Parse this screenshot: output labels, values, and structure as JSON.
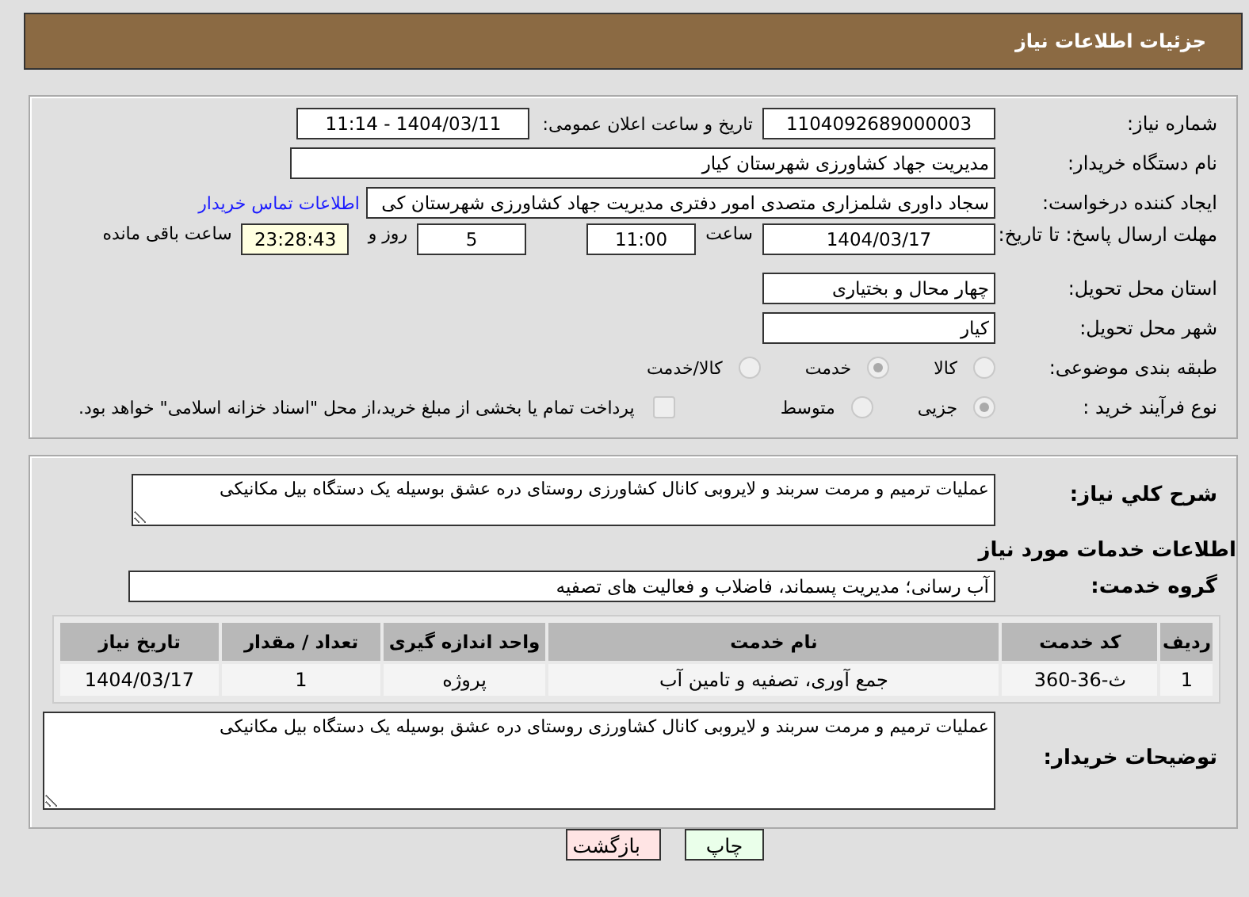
{
  "header": {
    "title": "جزئیات اطلاعات نیاز"
  },
  "need": {
    "number_label": "شماره نیاز:",
    "number": "1104092689000003",
    "announce_label": "تاریخ و ساعت اعلان عمومی:",
    "announce": "1404/03/11 - 11:14",
    "buyer_label": "نام دستگاه خریدار:",
    "buyer": "مدیریت جهاد کشاورزی شهرستان کیار",
    "creator_label": "ایجاد کننده درخواست:",
    "creator": "سجاد داوری شلمزاری متصدی امور دفتری مدیریت جهاد کشاورزی شهرستان کی",
    "contact_link": "اطلاعات تماس خریدار",
    "deadline_label": "مهلت ارسال پاسخ: تا تاریخ:",
    "deadline_date": "1404/03/17",
    "time_label": "ساعت",
    "deadline_time": "11:00",
    "days": "5",
    "days_label": "روز و",
    "remaining": "23:28:43",
    "remaining_label": "ساعت باقی مانده",
    "province_label": "استان محل تحویل:",
    "province": "چهار محال و بختیاری",
    "city_label": "شهر محل تحویل:",
    "city": "کیار",
    "category": {
      "label": "طبقه بندی موضوعی:",
      "options": [
        {
          "label": "کالا",
          "selected": false
        },
        {
          "label": "خدمت",
          "selected": true
        },
        {
          "label": "کالا/خدمت",
          "selected": false
        }
      ]
    },
    "process": {
      "label": "نوع فرآیند خرید :",
      "options": [
        {
          "label": "جزیی",
          "selected": true
        },
        {
          "label": "متوسط",
          "selected": false
        }
      ],
      "checkbox": {
        "label": "پرداخت تمام یا بخشی از مبلغ خرید،از محل \"اسناد خزانه اسلامی\" خواهد بود.",
        "checked": false
      }
    }
  },
  "services": {
    "summary_label": "شرح کلي نياز:",
    "summary": "عملیات ترمیم و مرمت سربند و لایروبی کانال کشاورزی روستای دره عشق بوسیله یک دستگاه بیل مکانیکی",
    "heading": "اطلاعات خدمات مورد نیاز",
    "group_label": "گروه خدمت:",
    "group": "آب رسانی؛ مدیریت پسماند، فاضلاب و فعالیت های تصفیه",
    "table": {
      "columns": [
        "ردیف",
        "کد خدمت",
        "نام خدمت",
        "واحد اندازه گیری",
        "تعداد / مقدار",
        "تاریخ نیاز"
      ],
      "rows": [
        [
          "1",
          "ث-36-360",
          "جمع آوری، تصفیه و تامین آب",
          "پروژه",
          "1",
          "1404/03/17"
        ]
      ]
    },
    "notes_label": "توضیحات خریدار:",
    "notes": "عملیات ترمیم و مرمت سربند و لایروبی کانال کشاورزی روستای دره عشق بوسیله یک دستگاه بیل مکانیکی"
  },
  "buttons": [
    {
      "label": "چاپ",
      "kind": "print"
    },
    {
      "label": "بازگشت",
      "kind": "back"
    }
  ]
}
